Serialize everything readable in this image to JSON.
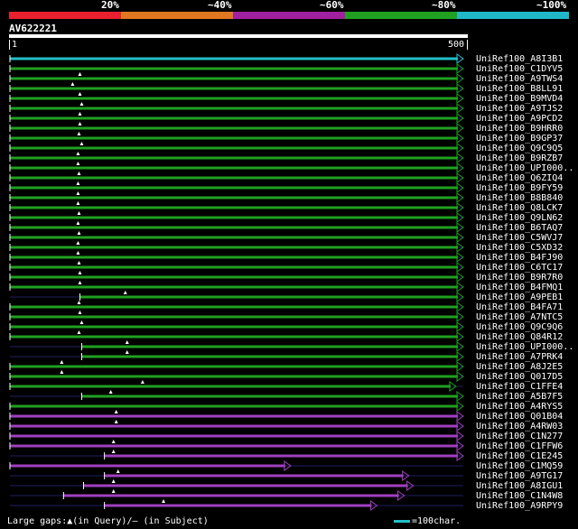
{
  "legend": {
    "labels": [
      "20%",
      "~40%",
      "~60%",
      "~80%",
      "~100%"
    ],
    "colors": [
      "#e8202e",
      "#e07820",
      "#a020a0",
      "#20a020",
      "#20b8c8"
    ]
  },
  "query": {
    "id": "AV622221",
    "start": "1",
    "end": "500"
  },
  "footer": {
    "gaps": "Large gaps:▲(in Query)/– (in Subject)",
    "scale": "=100char."
  },
  "hits": [
    {
      "label": "UniRef100_A8I3B1",
      "color": "#22c0c8",
      "s": 1,
      "e": 500,
      "pos": null
    },
    {
      "label": "UniRef100_C1DYV5",
      "color": "#20a020",
      "s": 1,
      "e": 500,
      "pos": null
    },
    {
      "label": "UniRef100_A9TWS4",
      "color": "#20a020",
      "s": 1,
      "e": 500,
      "pos": 78
    },
    {
      "label": "UniRef100_B8LL91",
      "color": "#20a020",
      "s": 1,
      "e": 500,
      "pos": 70
    },
    {
      "label": "UniRef100_B9MVD4",
      "color": "#20a020",
      "s": 1,
      "e": 500,
      "pos": 78
    },
    {
      "label": "UniRef100_A9TJS2",
      "color": "#20a020",
      "s": 1,
      "e": 500,
      "pos": 80
    },
    {
      "label": "UniRef100_A9PCD2",
      "color": "#20a020",
      "s": 1,
      "e": 500,
      "pos": 78
    },
    {
      "label": "UniRef100_B9HRR0",
      "color": "#20a020",
      "s": 1,
      "e": 500,
      "pos": 78
    },
    {
      "label": "UniRef100_B9GP37",
      "color": "#20a020",
      "s": 1,
      "e": 500,
      "pos": 77
    },
    {
      "label": "UniRef100_Q9C9Q5",
      "color": "#20a020",
      "s": 1,
      "e": 500,
      "pos": 80
    },
    {
      "label": "UniRef100_B9RZB7",
      "color": "#20a020",
      "s": 1,
      "e": 500,
      "pos": 76
    },
    {
      "label": "UniRef100_UPI000..",
      "color": "#20a020",
      "s": 1,
      "e": 500,
      "pos": 76
    },
    {
      "label": "UniRef100_Q6ZIQ4",
      "color": "#20a020",
      "s": 1,
      "e": 500,
      "pos": 77
    },
    {
      "label": "UniRef100_B9FY59",
      "color": "#20a020",
      "s": 1,
      "e": 500,
      "pos": 76
    },
    {
      "label": "UniRef100_B8B840",
      "color": "#20a020",
      "s": 1,
      "e": 500,
      "pos": 76
    },
    {
      "label": "UniRef100_Q8LCK7",
      "color": "#20a020",
      "s": 1,
      "e": 500,
      "pos": 76
    },
    {
      "label": "UniRef100_Q9LN62",
      "color": "#20a020",
      "s": 1,
      "e": 500,
      "pos": 77
    },
    {
      "label": "UniRef100_B6TAQ7",
      "color": "#20a020",
      "s": 1,
      "e": 500,
      "pos": 76
    },
    {
      "label": "UniRef100_C5WVJ7",
      "color": "#20a020",
      "s": 1,
      "e": 500,
      "pos": 77
    },
    {
      "label": "UniRef100_C5XD32",
      "color": "#20a020",
      "s": 1,
      "e": 500,
      "pos": 76
    },
    {
      "label": "UniRef100_B4FJ90",
      "color": "#20a020",
      "s": 1,
      "e": 500,
      "pos": 76
    },
    {
      "label": "UniRef100_C6TC17",
      "color": "#20a020",
      "s": 1,
      "e": 500,
      "pos": 77
    },
    {
      "label": "UniRef100_B9R7R0",
      "color": "#20a020",
      "s": 1,
      "e": 500,
      "pos": 78
    },
    {
      "label": "UniRef100_B4FMQ1",
      "color": "#20a020",
      "s": 1,
      "e": 500,
      "pos": 78
    },
    {
      "label": "UniRef100_A9PEB1",
      "color": "#20a020",
      "s": 78,
      "e": 500,
      "pos": 128
    },
    {
      "label": "UniRef100_B4FA71",
      "color": "#20a020",
      "s": 1,
      "e": 500,
      "pos": 77
    },
    {
      "label": "UniRef100_A7NTC5",
      "color": "#20a020",
      "s": 1,
      "e": 500,
      "pos": 78
    },
    {
      "label": "UniRef100_Q9C9Q6",
      "color": "#20a020",
      "s": 1,
      "e": 500,
      "pos": 80
    },
    {
      "label": "UniRef100_Q84R12",
      "color": "#20a020",
      "s": 1,
      "e": 500,
      "pos": 77
    },
    {
      "label": "UniRef100_UPI000..",
      "color": "#20a020",
      "s": 80,
      "e": 500,
      "pos": 130
    },
    {
      "label": "UniRef100_A7PRK4",
      "color": "#20a020",
      "s": 80,
      "e": 500,
      "pos": 130
    },
    {
      "label": "UniRef100_A8J2E5",
      "color": "#20a020",
      "s": 1,
      "e": 500,
      "pos": 58
    },
    {
      "label": "UniRef100_Q017D5",
      "color": "#20a020",
      "s": 1,
      "e": 500,
      "pos": 58
    },
    {
      "label": "UniRef100_C1FFE4",
      "color": "#20a020",
      "s": 1,
      "e": 492,
      "pos": 147
    },
    {
      "label": "UniRef100_A5B7F5",
      "color": "#20a020",
      "s": 80,
      "e": 500,
      "pos": 112
    },
    {
      "label": "UniRef100_A4RYS5",
      "color": "#20a020",
      "s": 1,
      "e": 500,
      "pos": null
    },
    {
      "label": "UniRef100_Q01B04",
      "color": "#a040c0",
      "s": 1,
      "e": 500,
      "pos": 118
    },
    {
      "label": "UniRef100_A4RW03",
      "color": "#a040c0",
      "s": 1,
      "e": 500,
      "pos": 118
    },
    {
      "label": "UniRef100_C1N277",
      "color": "#a040c0",
      "s": 1,
      "e": 500,
      "pos": null
    },
    {
      "label": "UniRef100_C1FFW6",
      "color": "#a040c0",
      "s": 1,
      "e": 500,
      "pos": 115
    },
    {
      "label": "UniRef100_C1E245",
      "color": "#a040c0",
      "s": 105,
      "e": 500,
      "pos": 115
    },
    {
      "label": "UniRef100_C1MQ59",
      "color": "#a040c0",
      "s": 1,
      "e": 310,
      "pos": null
    },
    {
      "label": "UniRef100_A9TG17",
      "color": "#a040c0",
      "s": 105,
      "e": 440,
      "pos": 120
    },
    {
      "label": "UniRef100_A8IGU1",
      "color": "#a040c0",
      "s": 82,
      "e": 445,
      "pos": 115
    },
    {
      "label": "UniRef100_C1N4W8",
      "color": "#a040c0",
      "s": 60,
      "e": 435,
      "pos": 115
    },
    {
      "label": "UniRef100_A9RPY9",
      "color": "#a040c0",
      "s": 105,
      "e": 405,
      "pos": 170
    }
  ]
}
